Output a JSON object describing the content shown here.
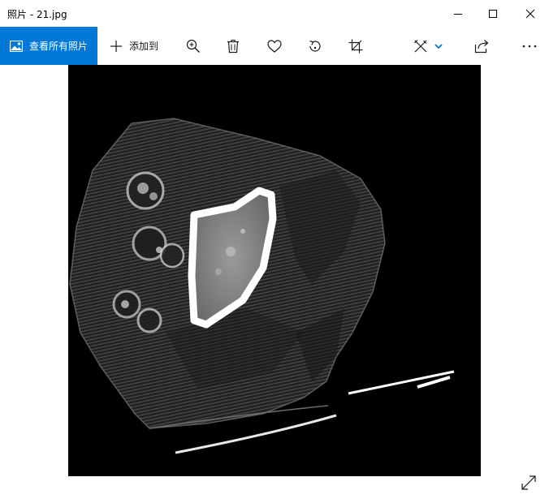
{
  "window": {
    "title": "照片 - 21.jpg"
  },
  "toolbar": {
    "view_all_label": "查看所有照片",
    "add_to_label": "添加到"
  },
  "colors": {
    "accent": "#0078d7",
    "viewer_background": "#000000"
  },
  "icons": [
    "photos-icon",
    "plus-icon",
    "zoom-in-icon",
    "delete-icon",
    "heart-icon",
    "rotate-icon",
    "crop-icon",
    "edit-icon",
    "chevron-down-icon",
    "share-icon",
    "more-icon",
    "minimize-icon",
    "maximize-icon",
    "close-icon",
    "fullscreen-icon"
  ]
}
